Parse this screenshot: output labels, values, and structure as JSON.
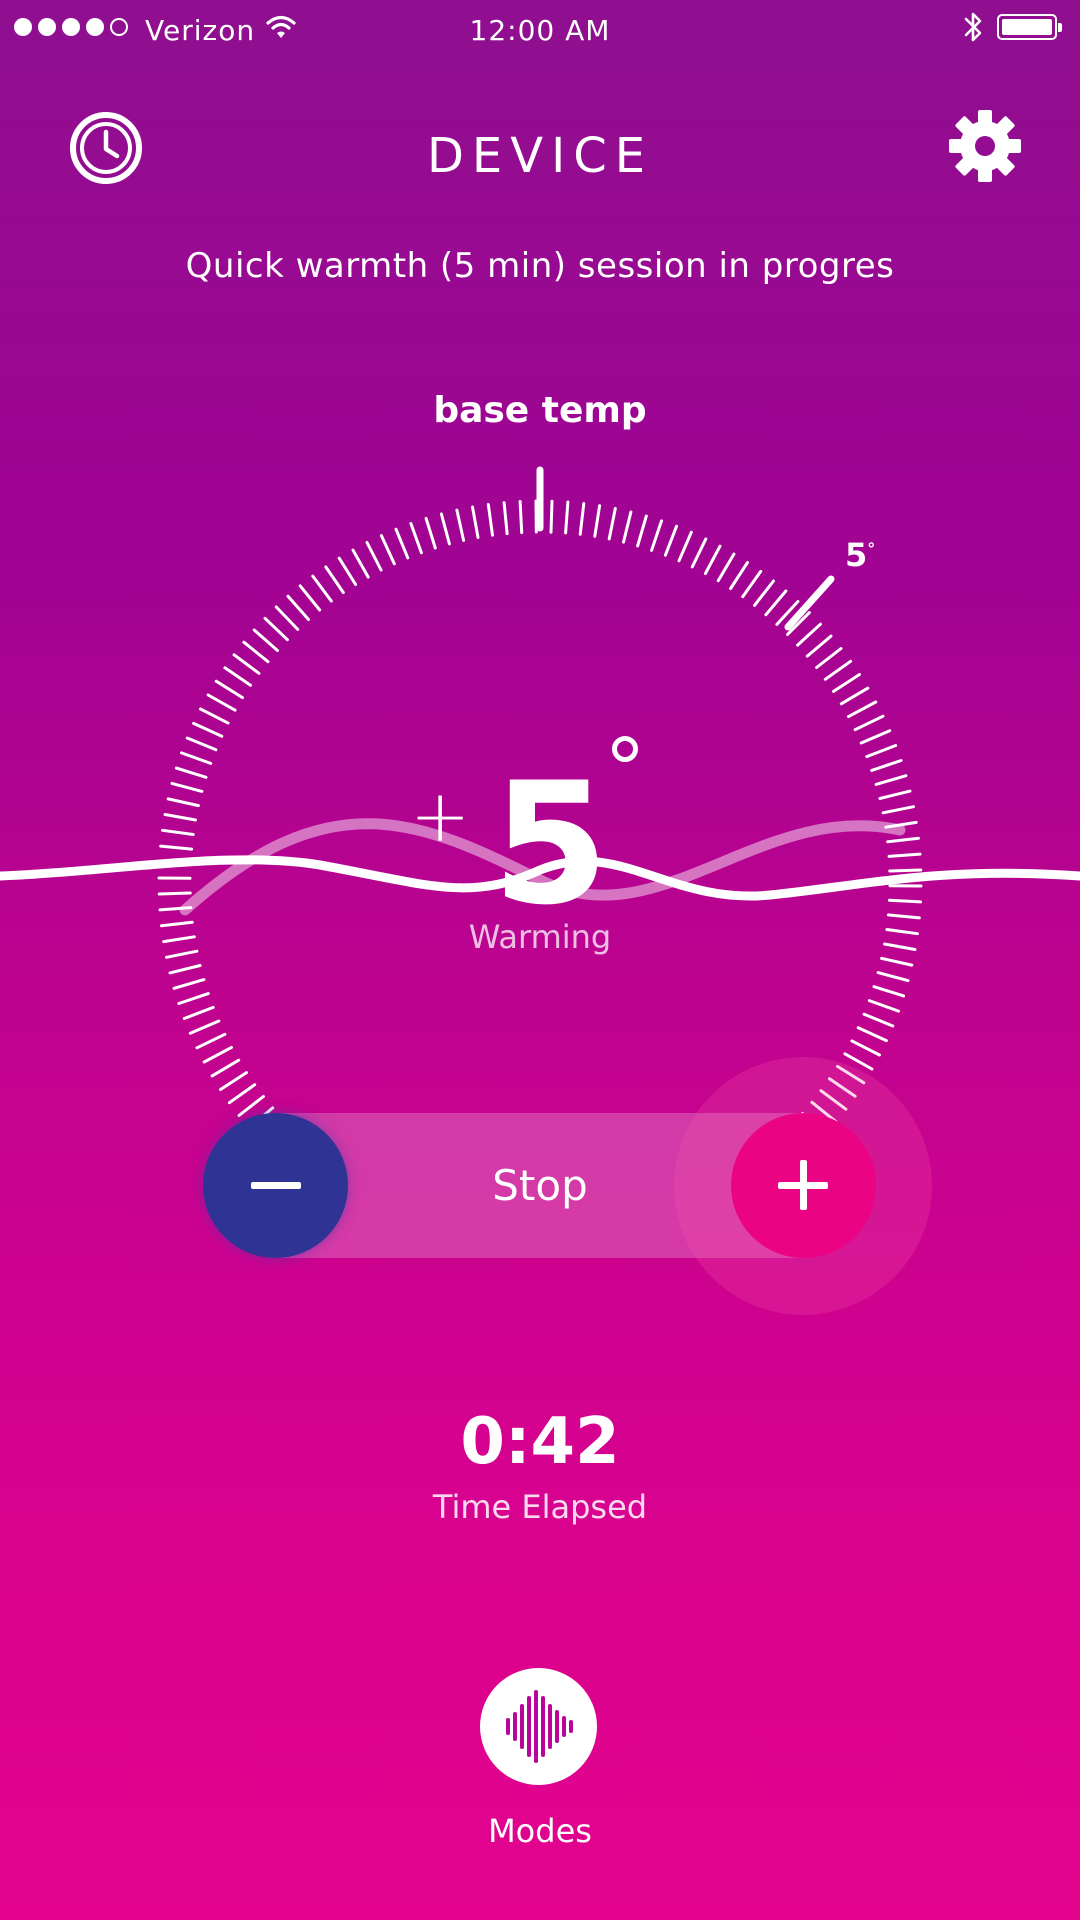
{
  "status_bar": {
    "carrier": "Verizon",
    "time": "12:00 AM",
    "signal_bars_filled": 4,
    "signal_bars_total": 5,
    "icons": [
      "wifi-icon",
      "bluetooth-icon",
      "battery-icon"
    ]
  },
  "header": {
    "title": "DEVICE",
    "left_icon": "history-clock-icon",
    "right_icon": "gear-icon"
  },
  "session_text": "Quick warmth (5 min) session in progres",
  "dial": {
    "label": "base temp",
    "offset_label": "5",
    "offset_unit": "°",
    "value_sign": "+",
    "value": "5",
    "status": "Warming"
  },
  "controls": {
    "minus_icon": "minus-icon",
    "stop_label": "Stop",
    "plus_icon": "plus-icon"
  },
  "timer": {
    "value": "0:42",
    "label": "Time Elapsed"
  },
  "modes": {
    "label": "Modes",
    "icon": "waveform-icon"
  },
  "colors": {
    "gradient_top": "#8f0f90",
    "gradient_bottom": "#e3038d",
    "minus_button": "#2e3394",
    "plus_button": "#ea0383"
  }
}
